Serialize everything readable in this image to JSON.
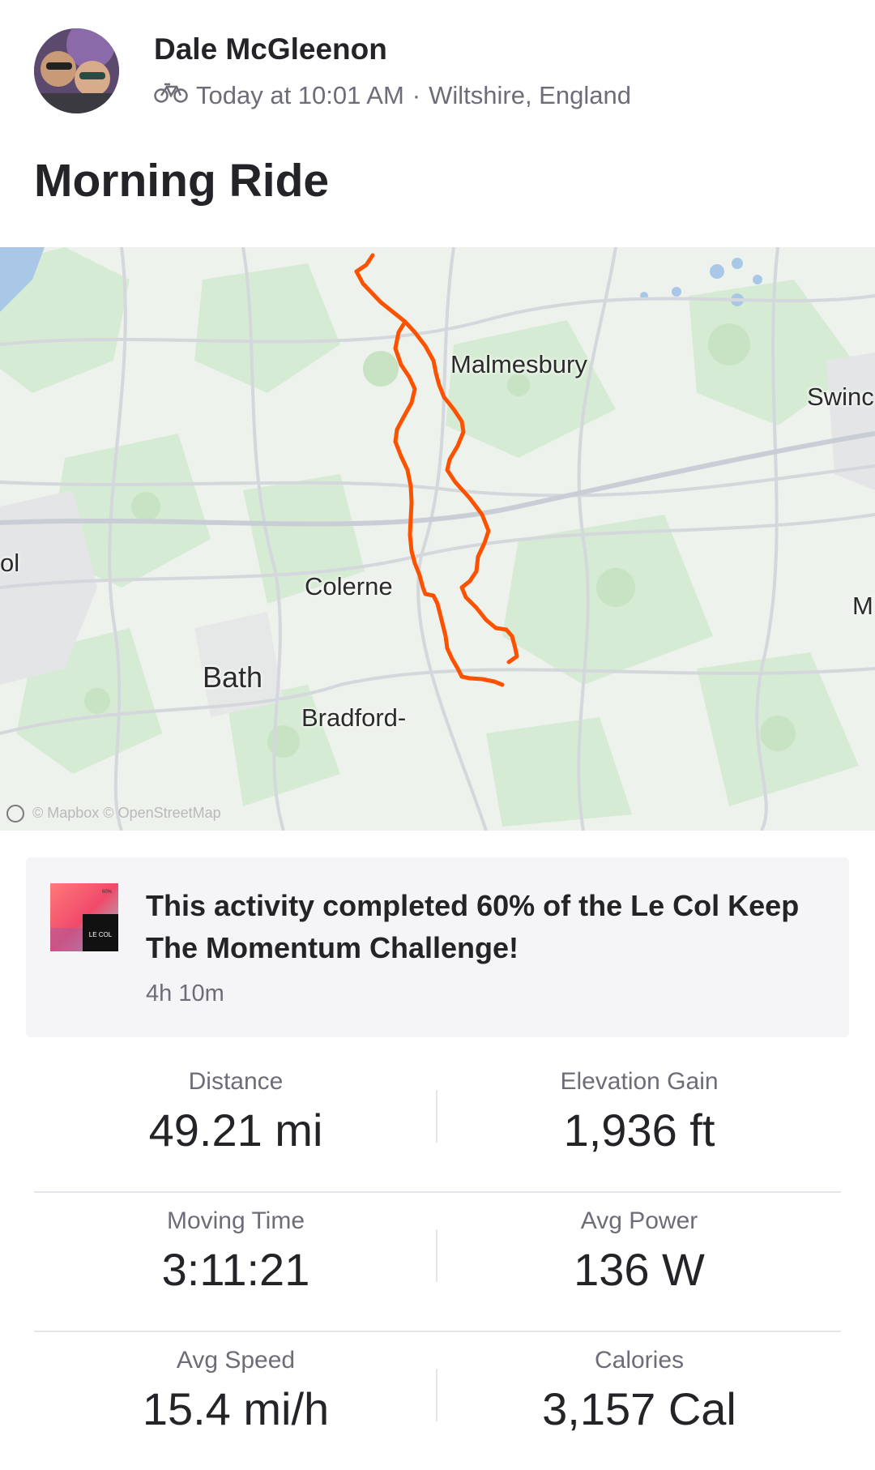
{
  "header": {
    "athlete_name": "Dale McGleenon",
    "activity_icon": "bike-icon",
    "timestamp": "Today at 10:01 AM",
    "separator": "·",
    "location": "Wiltshire, England",
    "activity_title": "Morning Ride"
  },
  "map": {
    "labels": {
      "malmesbury": "Malmesbury",
      "swindon": "Swinc",
      "bristol": "ol",
      "colerne": "Colerne",
      "bath": "Bath",
      "bradford": "Bradford-",
      "m": "M"
    },
    "attribution": "© Mapbox © OpenStreetMap",
    "route_color": "#fc5200"
  },
  "challenge": {
    "badge_text": "LE COL",
    "badge_percent": "60%",
    "text": "This activity completed 60% of the Le Col Keep The Momentum Challenge!",
    "duration": "4h 10m"
  },
  "stats": {
    "distance": {
      "label": "Distance",
      "value": "49.21 mi"
    },
    "elevation_gain": {
      "label": "Elevation Gain",
      "value": "1,936 ft"
    },
    "moving_time": {
      "label": "Moving Time",
      "value": "3:11:21"
    },
    "avg_power": {
      "label": "Avg Power",
      "value": "136 W"
    },
    "avg_speed": {
      "label": "Avg Speed",
      "value": "15.4 mi/h"
    },
    "calories": {
      "label": "Calories",
      "value": "3,157 Cal"
    }
  }
}
